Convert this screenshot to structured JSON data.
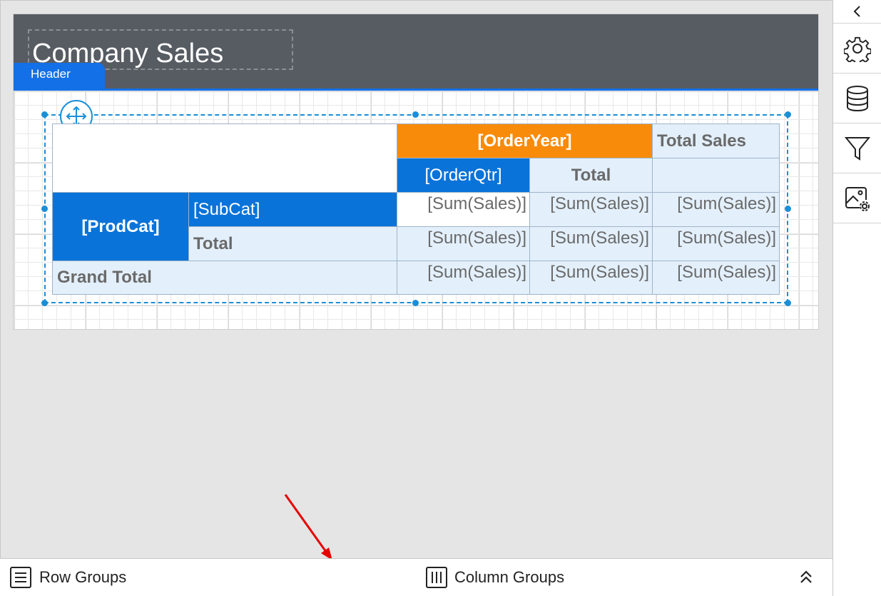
{
  "report": {
    "title": "Company Sales",
    "header_tab": "Header"
  },
  "tablix": {
    "col_group_header": "[OrderYear]",
    "col_total_sales": "Total Sales",
    "col_subgroup_header": "[OrderQtr]",
    "col_subtotal_header": "Total",
    "row_group_header": "[ProdCat]",
    "row_subgroup_header": "[SubCat]",
    "row_subtotal_label": "Total",
    "grand_total_label": "Grand Total",
    "cell_expr": "[Sum(Sales)]"
  },
  "sidebar": {
    "items": [
      {
        "name": "collapse",
        "icon": "chevron-left-icon"
      },
      {
        "name": "properties",
        "icon": "gear-icon"
      },
      {
        "name": "data",
        "icon": "database-icon"
      },
      {
        "name": "parameters",
        "icon": "filter-icon"
      },
      {
        "name": "image-manager",
        "icon": "image-settings-icon"
      }
    ]
  },
  "bottom_bar": {
    "row_groups_label": "Row Groups",
    "column_groups_label": "Column Groups",
    "expand_icon": "double-chevron-up-icon"
  },
  "colors": {
    "header_band": "#575c63",
    "accent_blue": "#0a73d9",
    "accent_orange": "#f98b0a",
    "selection": "#1a8fd6",
    "annotation_arrow": "#e60000"
  }
}
